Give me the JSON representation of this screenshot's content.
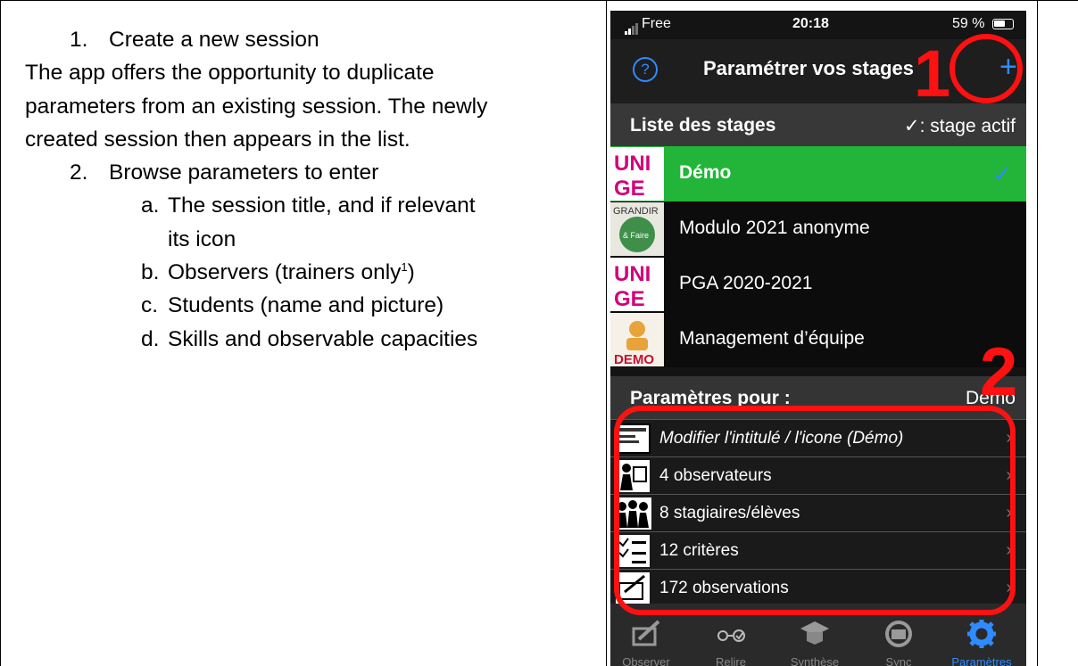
{
  "doc": {
    "item1": {
      "num": "1.",
      "text": "Create a new session"
    },
    "para": [
      "The app offers the opportunity to duplicate",
      "parameters from an existing session. The newly",
      "created session then appears in the list."
    ],
    "item2": {
      "num": "2.",
      "text": "Browse parameters to enter"
    },
    "subitems": [
      {
        "letter": "a.",
        "lines": [
          "The session title, and if relevant",
          "its icon"
        ]
      },
      {
        "letter": "b.",
        "text": "Observers (trainers only",
        "sup": "1",
        "after": ")"
      },
      {
        "letter": "c.",
        "text": "Students (name and picture)"
      },
      {
        "letter": "d.",
        "text": "Skills and observable capacities"
      }
    ]
  },
  "phone": {
    "status": {
      "carrier": "Free",
      "time": "20:18",
      "battery": "59 %"
    },
    "nav": {
      "help_icon": "question-circle-icon",
      "title": "Paramétrer vos stages",
      "add_icon": "plus-icon"
    },
    "list_header": {
      "left": "Liste des stages",
      "right": "✓: stage actif"
    },
    "stages": [
      {
        "label": "Démo",
        "active": true,
        "thumb_text": "UNI GE",
        "check": "✓"
      },
      {
        "label": "Modulo 2021 anonyme",
        "active": false,
        "thumb_text": "GRANDIR & Faire grandir"
      },
      {
        "label": "PGA 2020-2021",
        "active": false,
        "thumb_text": "UNI GE"
      },
      {
        "label": "Management d’équipe",
        "active": false,
        "thumb_text": "DEMO"
      }
    ],
    "params_header": {
      "left": "Paramètres pour :",
      "right": "Démo"
    },
    "params": [
      {
        "label": "Modifier l'intitulé / l'icone (Démo)",
        "italic": true,
        "icon": "edit-title-icon"
      },
      {
        "label": "4 observateurs",
        "icon": "observer-icon"
      },
      {
        "label": "8 stagiaires/élèves",
        "icon": "students-icon"
      },
      {
        "label": "12 critères",
        "icon": "criteria-icon"
      },
      {
        "label": "172 observations",
        "icon": "observations-icon"
      }
    ],
    "tabs": [
      {
        "label": "Observer",
        "icon": "observe-icon",
        "active": false
      },
      {
        "label": "Relire",
        "icon": "review-icon",
        "active": false
      },
      {
        "label": "Synthèse",
        "icon": "graduation-icon",
        "active": false
      },
      {
        "label": "Sync",
        "icon": "sync-icon",
        "active": false
      },
      {
        "label": "Paramètres",
        "icon": "gear-icon",
        "active": true
      }
    ],
    "annotations": [
      "1",
      "2"
    ],
    "colors": {
      "accent": "#2f8bff",
      "active_row": "#22b53a",
      "annotation": "#ff1111"
    }
  }
}
